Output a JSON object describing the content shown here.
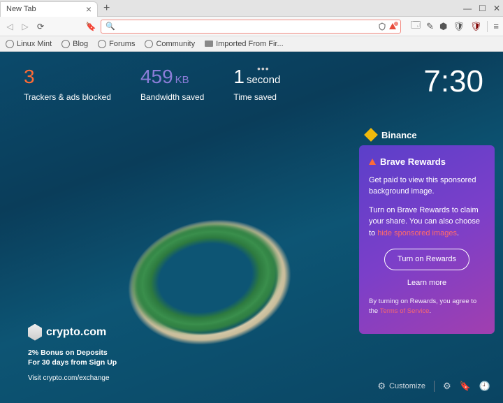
{
  "tab": {
    "title": "New Tab"
  },
  "bookmarks": [
    {
      "label": "Linux Mint",
      "kind": "site"
    },
    {
      "label": "Blog",
      "kind": "site"
    },
    {
      "label": "Forums",
      "kind": "site"
    },
    {
      "label": "Community",
      "kind": "site"
    },
    {
      "label": "Imported From Fir...",
      "kind": "folder"
    }
  ],
  "stats": {
    "trackers": {
      "value": "3",
      "label": "Trackers & ads blocked"
    },
    "bandwidth": {
      "value": "459",
      "unit": "KB",
      "label": "Bandwidth saved"
    },
    "time": {
      "value": "1",
      "unit": "second",
      "label": "Time saved"
    }
  },
  "clock": "7:30",
  "binance": {
    "label": "Binance"
  },
  "rewards": {
    "title": "Brave Rewards",
    "p1": "Get paid to view this sponsored background image.",
    "p2a": "Turn on Brave Rewards to claim your share. You can also choose to ",
    "p2link": "hide sponsored images",
    "p2b": ".",
    "button": "Turn on Rewards",
    "learn": "Learn more",
    "disclaimer_a": "By turning on Rewards, you agree to the ",
    "disclaimer_link": "Terms of Service",
    "disclaimer_b": "."
  },
  "sponsor": {
    "brand": "crypto.com",
    "line1": "2% Bonus on Deposits",
    "line2": "For 30 days from Sign Up",
    "visit": "Visit crypto.com/exchange"
  },
  "bottom": {
    "customize": "Customize"
  }
}
